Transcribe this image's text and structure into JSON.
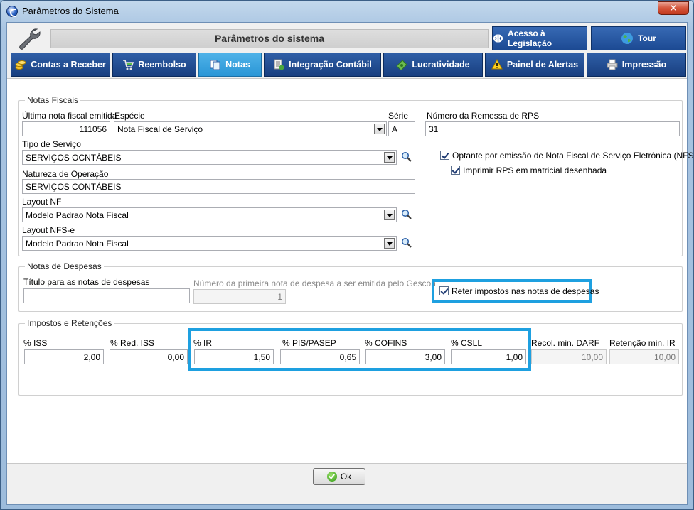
{
  "window": {
    "title": "Parâmetros do Sistema",
    "close_glyph": "✕"
  },
  "header": {
    "title": "Parâmetros do sistema",
    "legislacao_label": "Acesso à Legislação",
    "tour_label": "Tour"
  },
  "tabs": [
    {
      "label": "Contas a Receber",
      "icon": "coins-icon"
    },
    {
      "label": "Reembolso",
      "icon": "cart-icon"
    },
    {
      "label": "Notas",
      "icon": "documents-icon"
    },
    {
      "label": "Integração Contábil",
      "icon": "integration-icon"
    },
    {
      "label": "Lucratividade",
      "icon": "money-icon"
    },
    {
      "label": "Painel de Alertas",
      "icon": "warning-icon"
    },
    {
      "label": "Impressão",
      "icon": "printer-icon"
    }
  ],
  "active_tab": "Notas",
  "notas_fiscais": {
    "legend": "Notas Fiscais",
    "ultima_label": "Última nota fiscal emitida",
    "ultima_value": "111056",
    "especie_label": "Espécie",
    "especie_value": "Nota Fiscal de Serviço",
    "serie_label": "Série",
    "serie_value": "A",
    "remessa_label": "Número da Remessa de RPS",
    "remessa_value": "31",
    "tipo_label": "Tipo de Serviço",
    "tipo_value": "SERVIÇOS OCNTÁBEIS",
    "natureza_label": "Natureza de Operação",
    "natureza_value": "SERVIÇOS CONTÁBEIS",
    "layout_nf_label": "Layout NF",
    "layout_nf_value": "Modelo Padrao Nota Fiscal",
    "layout_nfse_label": "Layout NFS-e",
    "layout_nfse_value": "Modelo Padrao Nota Fiscal",
    "optante_label": "Optante por emissão de Nota Fiscal de Serviço Eletrônica (NFS-e)",
    "optante_checked": true,
    "imprimir_label": "Imprimir RPS em matricial desenhada",
    "imprimir_checked": true
  },
  "notas_despesas": {
    "legend": "Notas de Despesas",
    "titulo_label": "Título para as notas de despesas",
    "titulo_value": "",
    "primeira_label": "Número da primeira nota de despesa a ser emitida pelo Gescon",
    "primeira_value": "1",
    "reter_label": "Reter impostos nas notas de despesas",
    "reter_checked": true
  },
  "impostos": {
    "legend": "Impostos e Retenções",
    "iss_label": "% ISS",
    "iss_value": "2,00",
    "red_iss_label": "% Red. ISS",
    "red_iss_value": "0,00",
    "ir_label": "% IR",
    "ir_value": "1,50",
    "pis_label": "% PIS/PASEP",
    "pis_value": "0,65",
    "cofins_label": "% COFINS",
    "cofins_value": "3,00",
    "csll_label": "% CSLL",
    "csll_value": "1,00",
    "darf_label": "Recol. min. DARF",
    "darf_value": "10,00",
    "retencao_label": "Retenção min. IR",
    "retencao_value": "10,00"
  },
  "footer": {
    "ok_label": "Ok"
  },
  "colors": {
    "tab_bg": "#1f4a8f",
    "tab_active": "#36a3e0",
    "highlight": "#1ea0e0"
  }
}
